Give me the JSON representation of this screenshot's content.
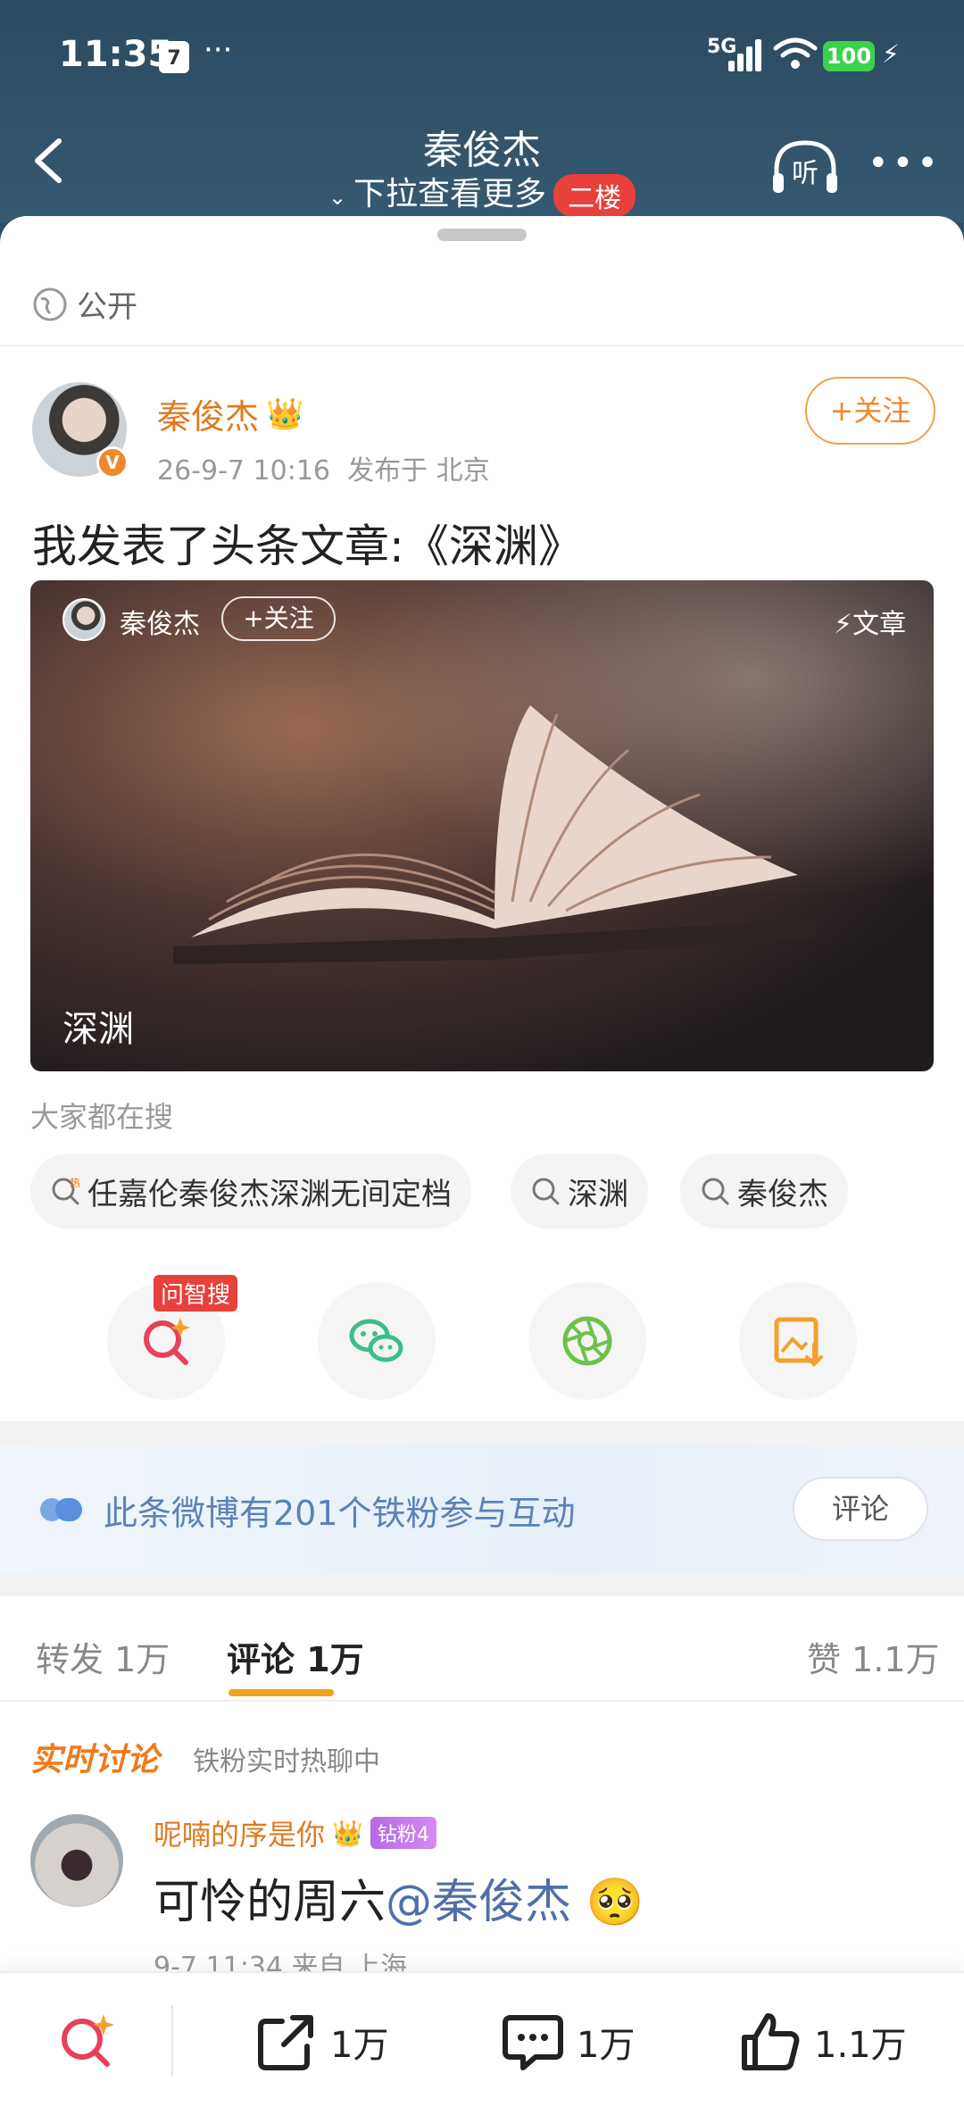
{
  "status_bar": {
    "time": "11:35",
    "calendar_day": "7",
    "dots": "···",
    "network": "5G",
    "battery": "100"
  },
  "nav": {
    "title": "秦俊杰",
    "subtitle": "下拉查看更多",
    "floor_badge": "二楼"
  },
  "visibility": "公开",
  "post": {
    "author": "秦俊杰",
    "date": "26-9-7 10:16",
    "location": "发布于 北京",
    "follow_label": "+关注",
    "text": "我发表了头条文章:《深渊》",
    "card": {
      "author": "秦俊杰",
      "follow_label": "+关注",
      "tag": "文章",
      "title": "深渊"
    }
  },
  "search": {
    "label": "大家都在搜",
    "chips": [
      "任嘉伦秦俊杰深渊无间定档",
      "深渊",
      "秦俊杰"
    ]
  },
  "share": {
    "ai_badge": "问智搜",
    "items": [
      "ai-search-icon",
      "wechat-icon",
      "moments-icon",
      "save-image-icon"
    ]
  },
  "fans": {
    "text": "此条微博有201个铁粉参与互动",
    "button": "评论"
  },
  "tabs": {
    "repost": "转发 1万",
    "comment": "评论 1万",
    "like": "赞 1.1万"
  },
  "realtime": {
    "title": "实时讨论",
    "subtitle": "铁粉实时热聊中"
  },
  "comment": {
    "user": "呢喃的序是你",
    "badge": "钻粉4",
    "text_prefix": "可怜的周六",
    "mention": "@秦俊杰",
    "emoji": "🥺",
    "meta": "9-7 11:34  来自 上海"
  },
  "bottom_bar": {
    "repost_count": "1万",
    "comment_count": "1万",
    "like_count": "1.1万"
  },
  "colors": {
    "accent_orange": "#f0882a",
    "fans_blue": "#5a82b8",
    "tab_underline": "#f0a21a",
    "header_bg": "#2b4a60"
  }
}
